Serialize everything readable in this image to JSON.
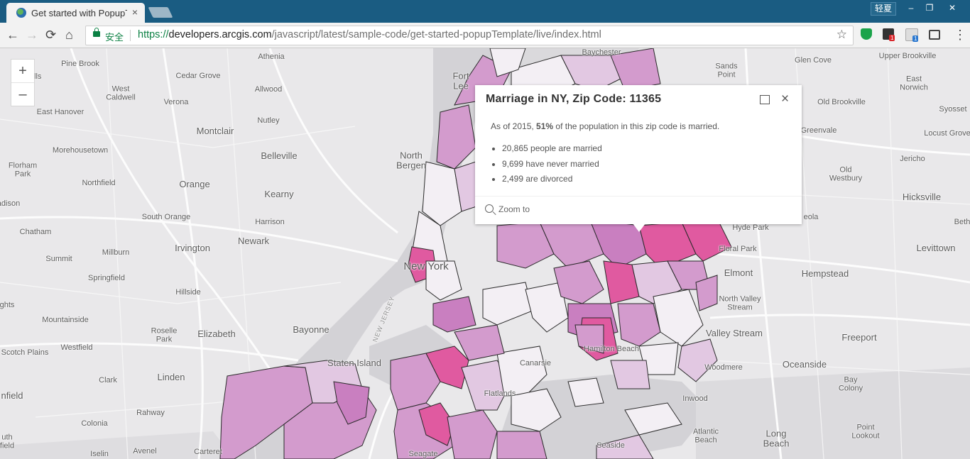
{
  "browser": {
    "tab_title": "Get started with PopupTemplate",
    "tab_close": "×",
    "window_label": "轻夏",
    "win_minimize": "‒",
    "win_restore": "❐",
    "win_close": "✕",
    "secure_text": "安全",
    "url_scheme": "https://",
    "url_host": "developers.arcgis.com",
    "url_path": "/javascript/latest/sample-code/get-started-popupTemplate/live/index.html",
    "back_icon": "←",
    "forward_icon": "→",
    "reload_icon": "⟳",
    "home_icon": "⌂",
    "star_icon": "☆",
    "menu_icon": "⋮",
    "ext_badge_1": "1",
    "ext_badge_2": "1"
  },
  "map": {
    "zoom_in": "+",
    "zoom_out": "–",
    "labels": {
      "pine_brook": "Pine Brook",
      "athenia": "Athenia",
      "baychester": "Baychester",
      "glen_cove": "Glen Cove",
      "upper_brookville": "Upper Brookville",
      "cedar_grove": "Cedar Grove",
      "fort_lee": "Fort\nLee",
      "sands_point": "Sands\nPoint",
      "east_norwich": "East\nNorwich",
      "west_caldwell": "West\nCaldwell",
      "allwood": "Allwood",
      "verona": "Verona",
      "old_brookville": "Old Brookville",
      "syosset": "Syosset",
      "east_hanover": "East Hanover",
      "nutley": "Nutley",
      "montclair": "Montclair",
      "greenvale": "Greenvale",
      "locust_grove": "Locust Grove",
      "morehousetown": "Morehousetown",
      "belleville": "Belleville",
      "north_bergen": "North\nBergen",
      "florham_park": "Florham\nPark",
      "jericho": "Jericho",
      "old_westbury": "Old\nWestbury",
      "northfield": "Northfield",
      "orange": "Orange",
      "kearny": "Kearny",
      "hicksville": "Hicksville",
      "madison": "adison",
      "south_orange": "South Orange",
      "harrison": "Harrison",
      "roslyn_heights": "eola",
      "bethpage": "Beth",
      "chatham": "Chatham",
      "newark": "Newark",
      "hyde_park": "Hyde Park",
      "millburn": "Millburn",
      "irvington": "Irvington",
      "floral_park": "Floral Park",
      "levittown": "Levittown",
      "summit": "Summit",
      "new_york": "New York",
      "elmont": "Elmont",
      "hempstead": "Hempstead",
      "springfield": "Springfield",
      "hillside": "Hillside",
      "north_valley_stream": "North Valley\nStream",
      "heights": "ghts",
      "mountainside": "Mountainside",
      "bayonne": "Bayonne",
      "new_jersey": "NEW JERSEY",
      "roselle_park": "Roselle\nPark",
      "elizabeth": "Elizabeth",
      "valley_stream": "Valley Stream",
      "freeport": "Freeport",
      "scotch_plains": "Scotch Plains",
      "westfield": "Westfield",
      "hamilton_beach": "Hamilton Beach",
      "staten_island": "Staten Island",
      "canarsie": "Canarsie",
      "woodmere": "Woodmere",
      "oceanside": "Oceanside",
      "clark": "Clark",
      "linden": "Linden",
      "bay_colony": "Bay\nColony",
      "plainfield": "nfield",
      "flatlands": "Flatlands",
      "inwood": "Inwood",
      "rahway": "Rahway",
      "colonia": "Colonia",
      "atlantic_beach": "Atlantic\nBeach",
      "long_beach": "Long\nBeach",
      "point_lookout": "Point\nLookout",
      "south_plainfield": "uth\nfield",
      "iselin": "Iselin",
      "avenel": "Avenel",
      "carteret": "Carteret",
      "seagate": "Seagate",
      "seaside": "Seaside",
      "hills": "ills"
    },
    "colors": {
      "background": "#e9e8ea",
      "water": "#d3d2d6",
      "zip_low": "#f3eff4",
      "zip_light": "#e2c8e2",
      "zip_mid": "#d39bcd",
      "zip_high": "#c97fc0",
      "zip_max": "#e05aa0"
    }
  },
  "popup": {
    "title": "Marriage in NY, Zip Code: 11365",
    "desc_prefix": "As of 2015, ",
    "desc_percent": "51%",
    "desc_suffix": " of the population in this zip code is married.",
    "items": [
      "20,865 people are married",
      "9,699 have never married",
      "2,499 are divorced"
    ],
    "zoom_to": "Zoom to",
    "dock_icon": "dock-icon",
    "close_icon": "×"
  }
}
